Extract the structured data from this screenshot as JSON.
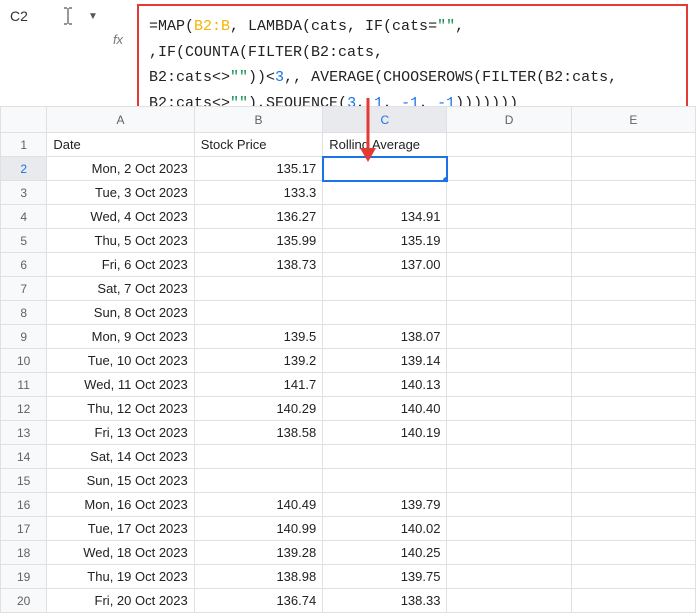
{
  "cellRef": "C2",
  "formula_parts": [
    {
      "t": "=MAP(",
      "c": "tok-fn"
    },
    {
      "t": "B2:B",
      "c": "tok-range1"
    },
    {
      "t": ", LAMBDA(cats, IF(cats=",
      "c": "tok-fn"
    },
    {
      "t": "\"\"",
      "c": "tok-str"
    },
    {
      "t": ", ,IF(COUNTA(FILTER(B2:cats,",
      "c": "tok-fn"
    },
    {
      "br": true
    },
    {
      "t": "B2:cats<>",
      "c": "tok-fn"
    },
    {
      "t": "\"\"",
      "c": "tok-str"
    },
    {
      "t": "))<",
      "c": "tok-fn"
    },
    {
      "t": "3",
      "c": "tok-num"
    },
    {
      "t": ",, AVERAGE(CHOOSEROWS(FILTER(B2:cats,",
      "c": "tok-fn"
    },
    {
      "br": true
    },
    {
      "t": "B2:cats<>",
      "c": "tok-fn"
    },
    {
      "t": "\"\"",
      "c": "tok-str"
    },
    {
      "t": "),SEQUENCE(",
      "c": "tok-fn"
    },
    {
      "t": "3",
      "c": "tok-num"
    },
    {
      "t": ", ",
      "c": "tok-fn"
    },
    {
      "t": "1",
      "c": "tok-num"
    },
    {
      "t": ", ",
      "c": "tok-fn"
    },
    {
      "t": "-1",
      "c": "tok-num"
    },
    {
      "t": ", ",
      "c": "tok-fn"
    },
    {
      "t": "-1",
      "c": "tok-num"
    },
    {
      "t": ")))))))",
      "c": "tok-fn"
    }
  ],
  "columns": [
    "A",
    "B",
    "C",
    "D",
    "E"
  ],
  "selectedCol": "C",
  "selectedRow": 2,
  "rows": [
    {
      "n": 1,
      "a": "Date",
      "b": "Stock Price",
      "c": "Rolling Average",
      "aleft": true,
      "bleft": true,
      "cleft": true
    },
    {
      "n": 2,
      "a": "Mon, 2 Oct 2023",
      "b": "135.17",
      "c": "",
      "sel": true
    },
    {
      "n": 3,
      "a": "Tue, 3 Oct 2023",
      "b": "133.3",
      "c": ""
    },
    {
      "n": 4,
      "a": "Wed, 4 Oct 2023",
      "b": "136.27",
      "c": "134.91"
    },
    {
      "n": 5,
      "a": "Thu, 5 Oct 2023",
      "b": "135.99",
      "c": "135.19"
    },
    {
      "n": 6,
      "a": "Fri, 6 Oct 2023",
      "b": "138.73",
      "c": "137.00"
    },
    {
      "n": 7,
      "a": "Sat, 7 Oct 2023",
      "b": "",
      "c": ""
    },
    {
      "n": 8,
      "a": "Sun, 8 Oct 2023",
      "b": "",
      "c": ""
    },
    {
      "n": 9,
      "a": "Mon, 9 Oct 2023",
      "b": "139.5",
      "c": "138.07"
    },
    {
      "n": 10,
      "a": "Tue, 10 Oct 2023",
      "b": "139.2",
      "c": "139.14"
    },
    {
      "n": 11,
      "a": "Wed, 11 Oct 2023",
      "b": "141.7",
      "c": "140.13"
    },
    {
      "n": 12,
      "a": "Thu, 12 Oct 2023",
      "b": "140.29",
      "c": "140.40"
    },
    {
      "n": 13,
      "a": "Fri, 13 Oct 2023",
      "b": "138.58",
      "c": "140.19"
    },
    {
      "n": 14,
      "a": "Sat, 14 Oct 2023",
      "b": "",
      "c": ""
    },
    {
      "n": 15,
      "a": "Sun, 15 Oct 2023",
      "b": "",
      "c": ""
    },
    {
      "n": 16,
      "a": "Mon, 16 Oct 2023",
      "b": "140.49",
      "c": "139.79"
    },
    {
      "n": 17,
      "a": "Tue, 17 Oct 2023",
      "b": "140.99",
      "c": "140.02"
    },
    {
      "n": 18,
      "a": "Wed, 18 Oct 2023",
      "b": "139.28",
      "c": "140.25"
    },
    {
      "n": 19,
      "a": "Thu, 19 Oct 2023",
      "b": "138.98",
      "c": "139.75"
    },
    {
      "n": 20,
      "a": "Fri, 20 Oct 2023",
      "b": "136.74",
      "c": "138.33"
    }
  ]
}
